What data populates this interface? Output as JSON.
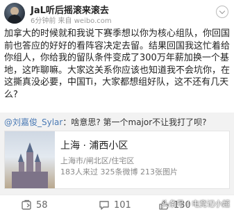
{
  "post": {
    "username": "JaL听后摇滚来滚去",
    "source": "6分钟前 来自 weibo.com",
    "body": "加拿大的时候就和我说下赛季想以你为核心组队，你回国前也答应的好好的看阵容决定去留。结果回国我这忙着给你组人，你给我的留队条件变成了300万年薪加换一个基地，这咋聊嘛。大家这关系你应该也知道我不会坑你，在这撕真没必要，中国Ti，大家都想组好队，这不还有几天么?"
  },
  "repost": {
    "mention": "@刘嘉俊_Sylar",
    "text": "：啥意思? 第一个major不让我打了呗?"
  },
  "location": {
    "name": "上海 · 浦西小区",
    "address": "上海市/闸北区/住宅区",
    "stats": "183人来过 325条微博 213张图片"
  },
  "actions": {
    "reposts": "58",
    "comments": "101",
    "likes": "130"
  },
  "watermark": "头条号 / 电竞记小超"
}
